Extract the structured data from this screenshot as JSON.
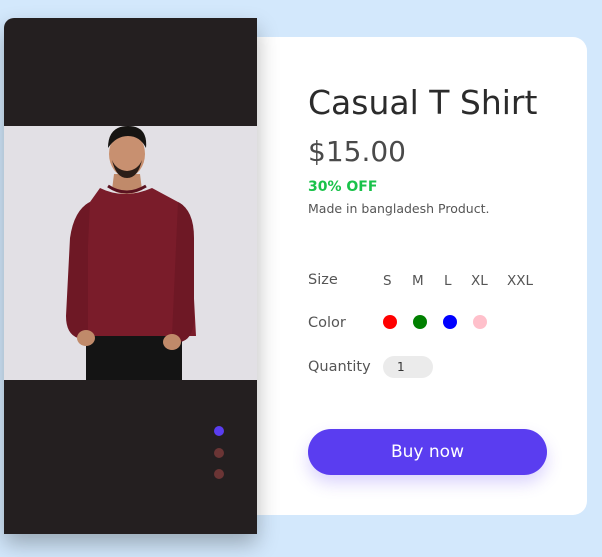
{
  "product": {
    "title": "Casual T Shirt",
    "price": "$15.00",
    "discount": "30% OFF",
    "origin": "Made in bangladesh Product."
  },
  "size": {
    "label": "Size",
    "options": [
      "S",
      "M",
      "L",
      "XL",
      "XXL"
    ]
  },
  "color": {
    "label": "Color",
    "swatches": [
      {
        "name": "red",
        "hex": "#ff0000"
      },
      {
        "name": "green",
        "hex": "#008000"
      },
      {
        "name": "blue",
        "hex": "#0000ff"
      },
      {
        "name": "pink",
        "hex": "#ffc0cb"
      }
    ]
  },
  "quantity": {
    "label": "Quantity",
    "value": "1"
  },
  "buy_button": {
    "label": "Buy now"
  },
  "carousel": {
    "dot_colors": [
      "#5a3df0",
      "#6b3535",
      "#6b3535"
    ],
    "active_index": 0
  },
  "theme": {
    "background": "#d3e8fc",
    "accent": "#5a3df0",
    "image_panel": "#241f20",
    "discount_green": "#19c24a"
  }
}
